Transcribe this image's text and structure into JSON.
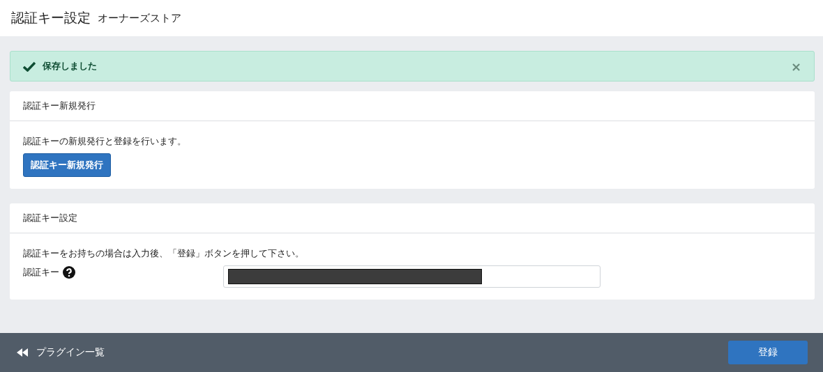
{
  "header": {
    "title": "認証キー設定",
    "subtitle": "オーナーズストア"
  },
  "alert": {
    "message": "保存しました",
    "close": "×"
  },
  "panels": [
    {
      "title": "認証キー新規発行",
      "description": "認証キーの新規発行と登録を行います。",
      "kind": "button",
      "button": "認証キー新規発行"
    },
    {
      "title": "認証キー設定",
      "description": "認証キーをお持ちの場合は入力後、「登録」ボタンを押して下さい。",
      "kind": "field",
      "field_label": "認証キー",
      "redacted": true
    }
  ],
  "footer": {
    "back_link": "プラグイン一覧",
    "submit": "登録"
  }
}
